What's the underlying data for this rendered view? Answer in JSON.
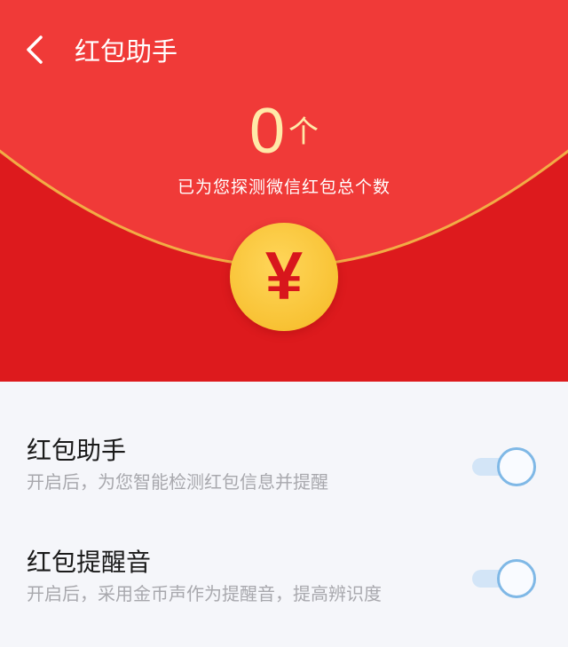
{
  "header": {
    "back_icon": "chevron-left-icon",
    "title": "红包助手"
  },
  "summary": {
    "count": "0",
    "unit": "个",
    "caption": "已为您探测微信红包总个数"
  },
  "coin": {
    "symbol": "¥",
    "icon": "yuan-coin-icon"
  },
  "settings": [
    {
      "title": "红包助手",
      "description": "开启后，为您智能检测红包信息并提醒",
      "enabled": true
    },
    {
      "title": "红包提醒音",
      "description": "开启后，采用金币声作为提醒音，提高辨识度",
      "enabled": true
    }
  ],
  "colors": {
    "hero_red": "#dd1a1d",
    "hero_upper_red": "#f03a38",
    "gold_accent": "#f3c34a",
    "count_text": "#ffe9a8",
    "toggle_knob_border": "#7fb8e6",
    "toggle_track": "#d3e5f7",
    "settings_bg": "#f5f6fa"
  }
}
